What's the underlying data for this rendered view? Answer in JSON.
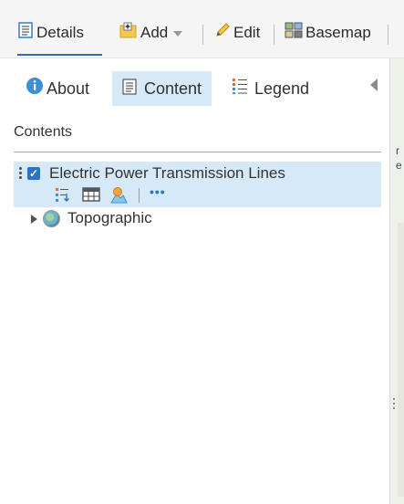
{
  "toolbar": {
    "details_label": "Details",
    "add_label": "Add",
    "edit_label": "Edit",
    "basemap_label": "Basemap"
  },
  "tabs": [
    {
      "label": "About",
      "icon": "info-icon"
    },
    {
      "label": "Content",
      "icon": "content-icon",
      "active": true
    },
    {
      "label": "Legend",
      "icon": "legend-icon"
    }
  ],
  "contents": {
    "heading": "Contents",
    "layers": [
      {
        "title": "Electric Power Transmission Lines",
        "checked": true,
        "selected": true
      },
      {
        "title": "Topographic",
        "type": "basemap",
        "expanded": false
      }
    ],
    "more_label": "•••"
  },
  "map_edge_text": [
    "r",
    "e"
  ],
  "colors": {
    "accent": "#2a72c7",
    "selection": "#d6e9f8",
    "toolbar_bg": "#f5f5f5"
  }
}
